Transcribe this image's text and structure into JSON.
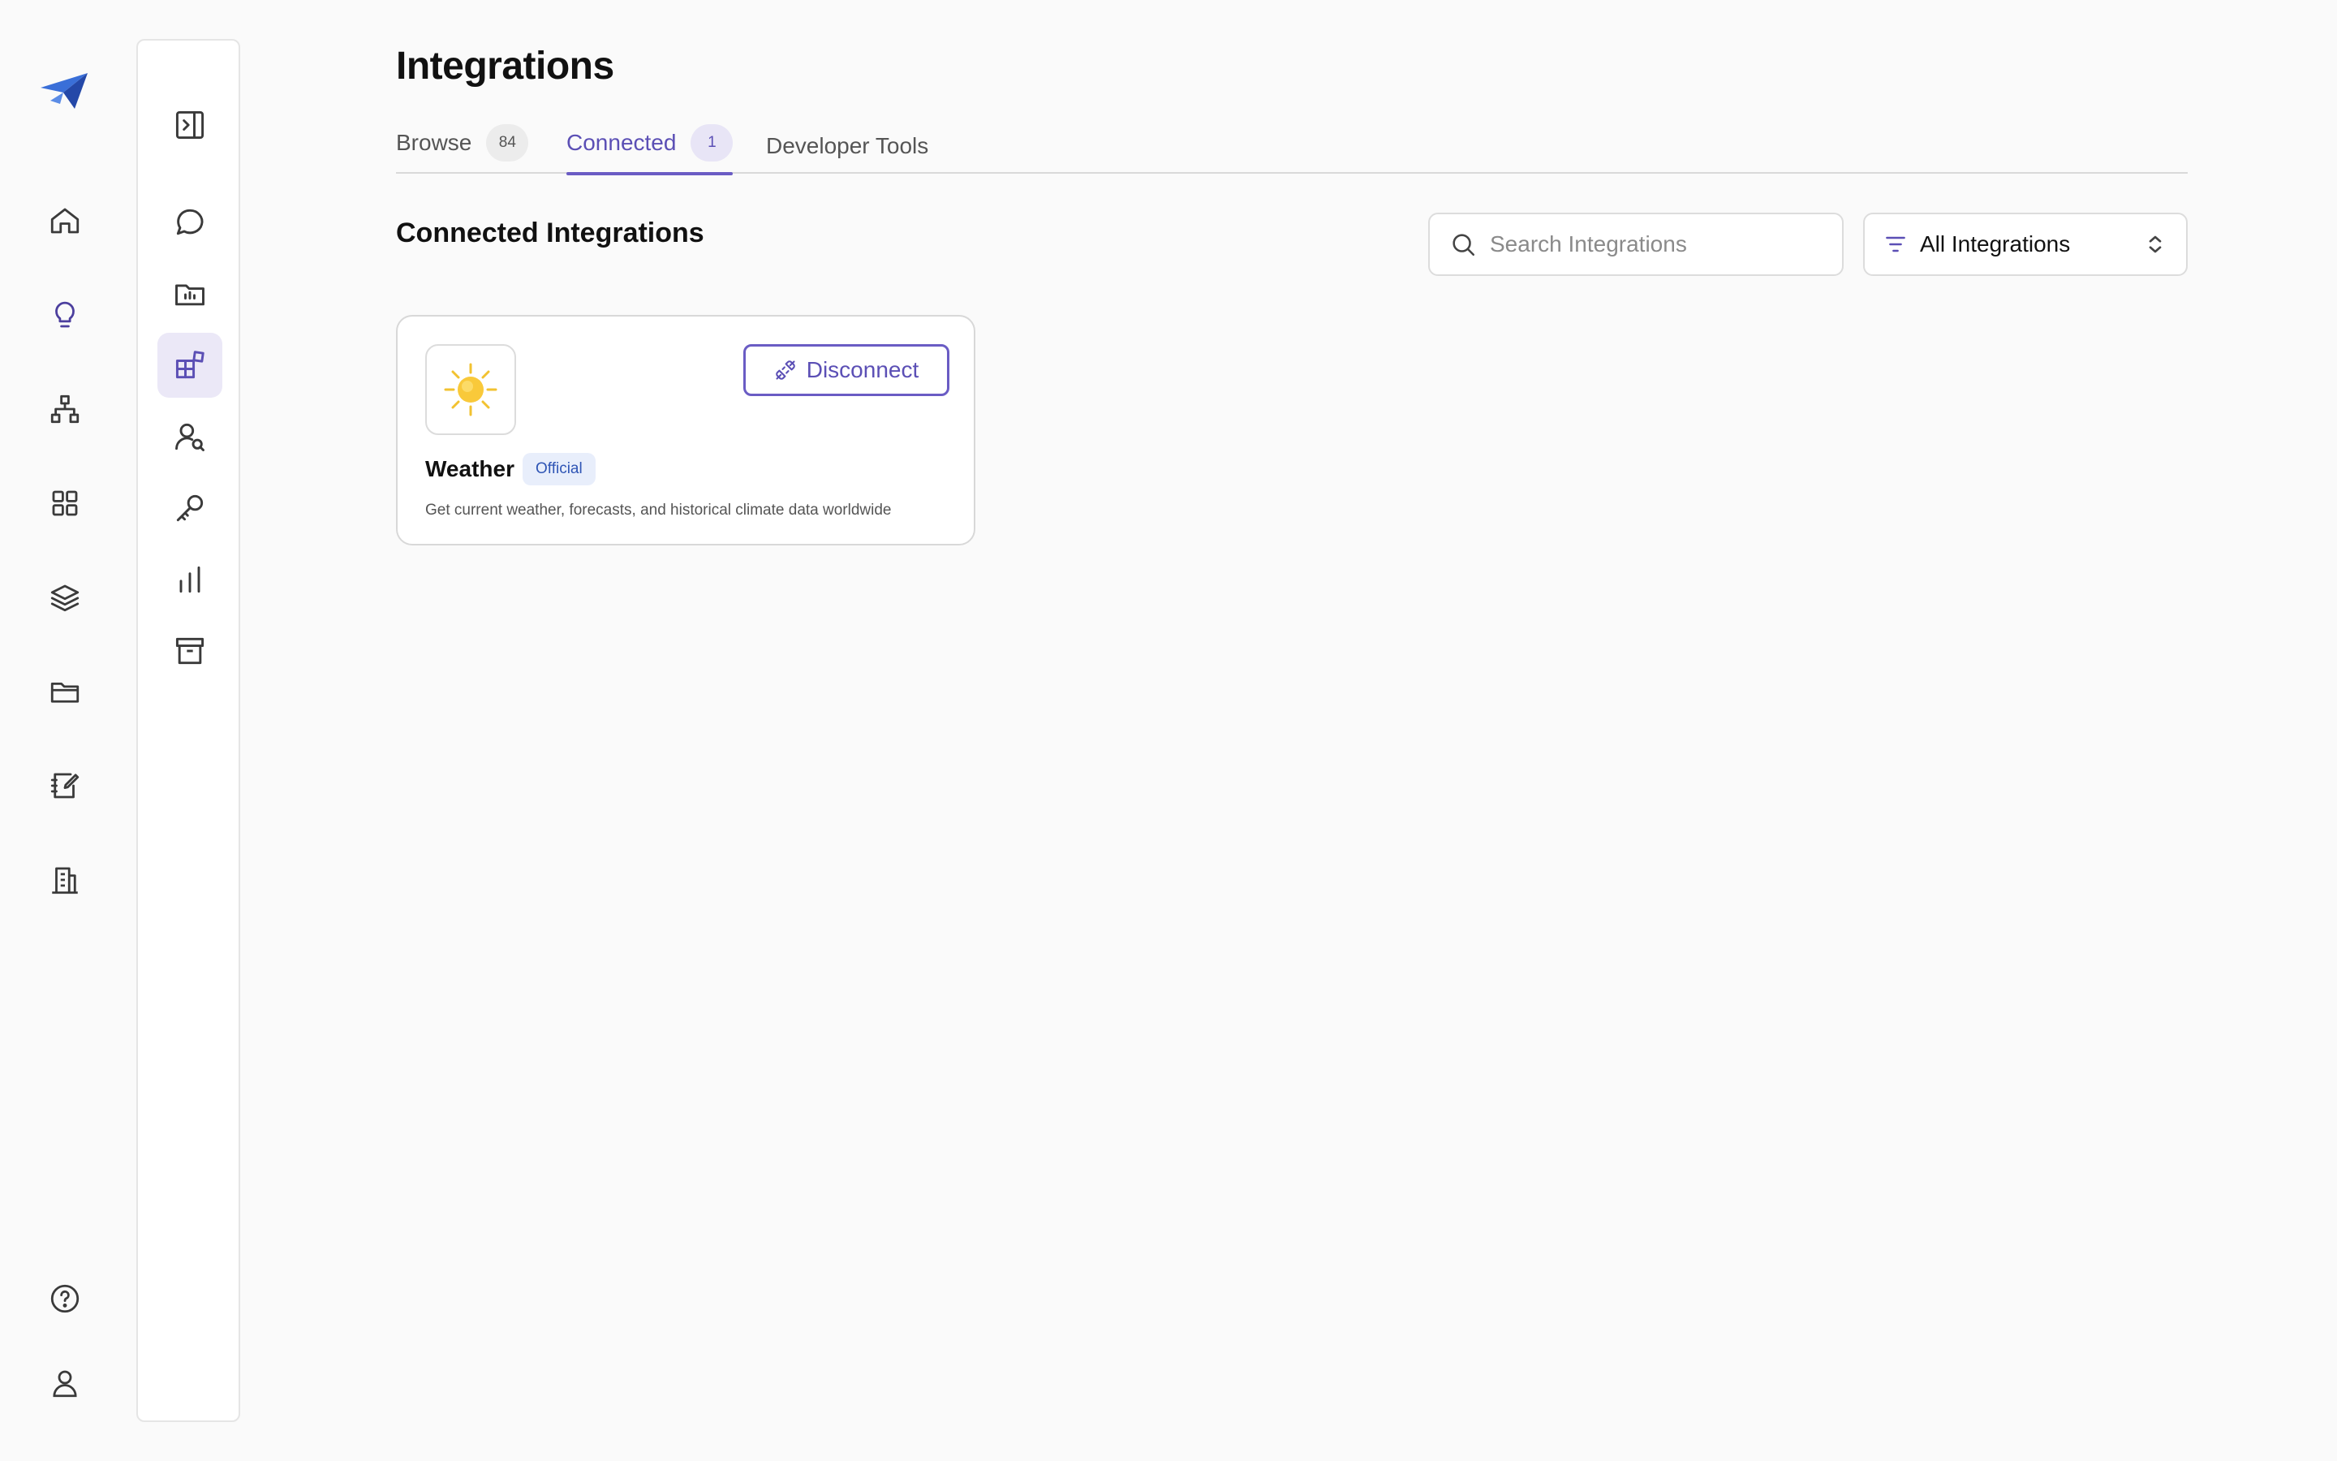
{
  "page": {
    "title": "Integrations"
  },
  "tabs": [
    {
      "label": "Browse",
      "count": "84"
    },
    {
      "label": "Connected",
      "count": "1"
    },
    {
      "label": "Developer Tools"
    }
  ],
  "section": {
    "title": "Connected Integrations"
  },
  "search": {
    "placeholder": "Search Integrations",
    "value": ""
  },
  "filter": {
    "selected": "All Integrations"
  },
  "integrations": [
    {
      "name": "Weather",
      "badge": "Official",
      "description": "Get current weather, forecasts, and historical climate data worldwide",
      "action": "Disconnect",
      "icon": "sun-icon"
    }
  ],
  "icons": {
    "rail": [
      "logo-icon",
      "home-icon",
      "lightbulb-icon",
      "hierarchy-icon",
      "grid-icon",
      "layers-icon",
      "folder-icon",
      "notebook-edit-icon",
      "building-icon",
      "help-icon",
      "user-icon"
    ],
    "subnav": [
      "expand-sidebar-icon",
      "chat-icon",
      "folder-chart-icon",
      "integrations-icon",
      "user-search-icon",
      "key-icon",
      "bar-chart-icon",
      "archive-icon"
    ]
  },
  "colors": {
    "accent": "#6a5cc4",
    "badge_bg": "#e8eefb",
    "badge_text": "#2f55b5"
  }
}
